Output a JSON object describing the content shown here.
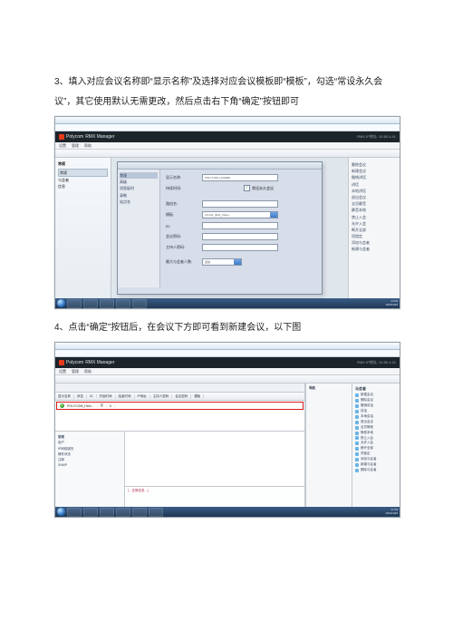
{
  "instruction_3": "3、填入对应会议名称即“显示名称”及选择对应会议模板即“模板”，勾选“常设永久会议”，其它使用默认无需更改，然后点击右下角“确定”按钮即可",
  "instruction_4": "4、点击“确定”按钮后，在会议下方即可看到新建会议，以下图",
  "app": {
    "vendor_label": "Polycom",
    "title": "RMX Manager",
    "right_text": "RMX IP地址: 10.80.4.41",
    "menus": [
      "设置",
      "管理",
      "帮助"
    ]
  },
  "shot1": {
    "left": {
      "header": "常规",
      "selected": "常规",
      "items": [
        "与会者",
        "信息"
      ]
    },
    "dialog_side": {
      "selected": "常规",
      "items": [
        "高级",
        "消息延时",
        "录制",
        "站点名"
      ]
    },
    "form": {
      "display_name_label": "显示名称:",
      "display_name_value": "POLYCOM_HUAWEI",
      "duration_label": "持续时间:",
      "perm_checkbox_label": "常设永久会议",
      "perm_checked": true,
      "routing_label": "路由名:",
      "template_label": "模板:",
      "template_value": "CU141_ID21_Video",
      "id_label": "ID:",
      "password_label": "会议密码:",
      "host_pwd_label": "主持人密码:",
      "max_parties_label": "最大与会者人数:",
      "max_parties_value": "自动"
    },
    "right_items": [
      "删除会议",
      "新建会议",
      "撤销讲话",
      "讲话",
      "本地讲话",
      "退出会议",
      "全员静音",
      "静音本地",
      "禁止入会",
      "允许入会",
      "断开全部",
      "项锁定",
      "添加与会者",
      "新建与会者",
      "删除与会者"
    ]
  },
  "shot2": {
    "toolbar_items": [
      "显示名称",
      "状态",
      "ID",
      "开始时间",
      "结束时间",
      "IP地址",
      "主持人密码",
      "会议密码",
      "模板"
    ],
    "row": {
      "name": "POLYCOM_HUA...",
      "status": "空",
      "id": "0"
    },
    "nav_header": "导航",
    "bottom_left": {
      "header": "常规",
      "items": [
        "用户",
        "IP网络服务",
        "硬件状态",
        "注释",
        "SNMP"
      ]
    },
    "right_panel": {
      "header": "与会者",
      "items": [
        "新建会议",
        "删除会议",
        "撤销讲话",
        "讲话",
        "本地讲话",
        "退出会议",
        "全员静音",
        "静音本地",
        "禁止入会",
        "允许入会",
        "断开全部",
        "项锁定",
        "添加与会者",
        "新建与会者",
        "删除与会者"
      ]
    },
    "log_line": "[…告警信息…]"
  },
  "taskbar_time": "17:03",
  "taskbar_date": "2016/4/26"
}
